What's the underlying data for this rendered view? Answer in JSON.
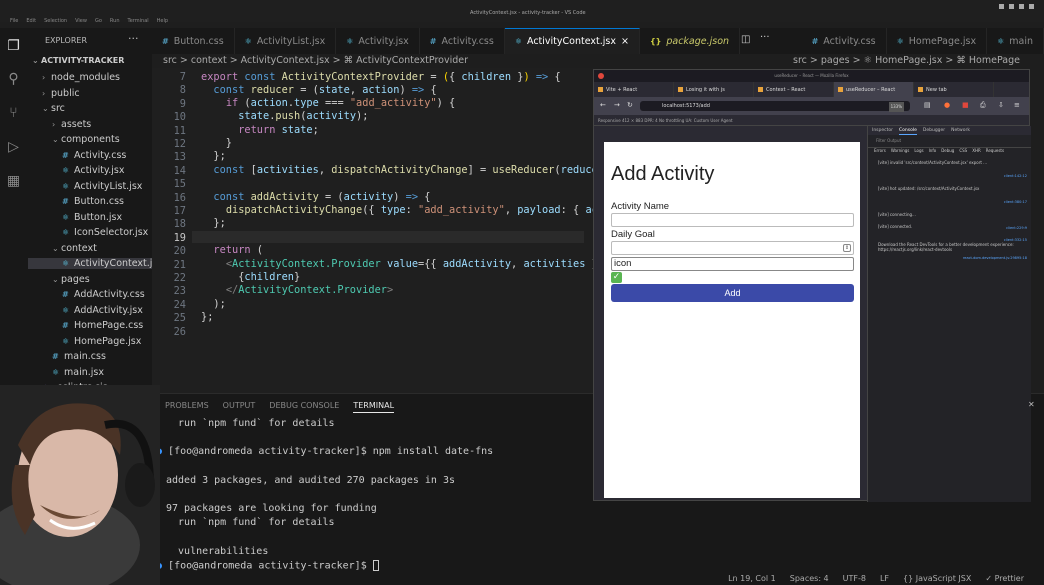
{
  "window": {
    "title": "ActivityContext.jsx - activity-tracker - VS Code"
  },
  "menu": [
    "File",
    "Edit",
    "Selection",
    "View",
    "Go",
    "Run",
    "Terminal",
    "Help"
  ],
  "explorer": {
    "title": "EXPLORER",
    "more": "···",
    "root": "ACTIVITY-TRACKER",
    "items": [
      {
        "label": "node_modules",
        "type": "folder",
        "open": false
      },
      {
        "label": "public",
        "type": "folder",
        "open": false
      },
      {
        "label": "src",
        "type": "folder",
        "open": true
      },
      {
        "label": "assets",
        "type": "folder",
        "open": false
      },
      {
        "label": "components",
        "type": "folder",
        "open": true
      },
      {
        "label": "Activity.css",
        "type": "css"
      },
      {
        "label": "Activity.jsx",
        "type": "jsx"
      },
      {
        "label": "ActivityList.jsx",
        "type": "jsx"
      },
      {
        "label": "Button.css",
        "type": "css"
      },
      {
        "label": "Button.jsx",
        "type": "jsx"
      },
      {
        "label": "IconSelector.jsx",
        "type": "jsx"
      },
      {
        "label": "context",
        "type": "folder",
        "open": true
      },
      {
        "label": "ActivityContext.jsx",
        "type": "jsx",
        "selected": true
      },
      {
        "label": "pages",
        "type": "folder",
        "open": true
      },
      {
        "label": "AddActivity.css",
        "type": "css"
      },
      {
        "label": "AddActivity.jsx",
        "type": "jsx"
      },
      {
        "label": "HomePage.css",
        "type": "css"
      },
      {
        "label": "HomePage.jsx",
        "type": "jsx"
      },
      {
        "label": "main.css",
        "type": "css"
      },
      {
        "label": "main.jsx",
        "type": "jsx"
      },
      {
        "label": ".eslintrc.cjs",
        "type": "eslint"
      }
    ]
  },
  "tabs": [
    {
      "label": "Button.css",
      "icon": "#",
      "iconColor": "#519aba"
    },
    {
      "label": "ActivityList.jsx",
      "icon": "⚛",
      "iconColor": "#61dafb"
    },
    {
      "label": "Activity.jsx",
      "icon": "⚛",
      "iconColor": "#61dafb"
    },
    {
      "label": "Activity.css",
      "icon": "#",
      "iconColor": "#519aba"
    },
    {
      "label": "ActivityContext.jsx",
      "icon": "⚛",
      "iconColor": "#61dafb",
      "active": true,
      "close": "×"
    },
    {
      "label": "package.json",
      "icon": "{}",
      "iconColor": "#cbcb41"
    },
    {
      "label": "Activity.css",
      "icon": "#",
      "iconColor": "#519aba"
    },
    {
      "label": "HomePage.jsx",
      "icon": "⚛",
      "iconColor": "#61dafb"
    },
    {
      "label": "main",
      "icon": "⚛",
      "iconColor": "#61dafb"
    }
  ],
  "breadcrumb": "src > context > ActivityContext.jsx > ⌘ ActivityContextProvider",
  "right_breadcrumb": "src > pages > ⚛ HomePage.jsx > ⌘ HomePage",
  "code": {
    "line_numbers": [
      "7",
      "8",
      "9",
      "10",
      "11",
      "12",
      "13",
      "14",
      "15",
      "16",
      "17",
      "18",
      "19",
      "20",
      "21",
      "22",
      "23",
      "24",
      "25",
      "26"
    ]
  },
  "panel": {
    "tabs": [
      "PROBLEMS",
      "OUTPUT",
      "DEBUG CONSOLE",
      "TERMINAL"
    ],
    "lines": [
      "  run `npm fund` for details",
      "",
      "[foo@andromeda activity-tracker]$ npm install date-fns",
      "",
      "added 3 packages, and audited 270 packages in 3s",
      "",
      "97 packages are looking for funding",
      "  run `npm fund` for details",
      "",
      "  vulnerabilities",
      "[foo@andromeda activity-tracker]$ "
    ]
  },
  "status": {
    "position": "Ln 19, Col 1",
    "spaces": "Spaces: 4",
    "encoding": "UTF-8",
    "eol": "LF",
    "language": "{} JavaScript JSX",
    "formatter": "✓ Prettier"
  },
  "browser": {
    "title": "useReducer – React — Mozilla Firefox",
    "tabs": [
      {
        "label": "Vite + React"
      },
      {
        "label": "Losing it with js"
      },
      {
        "label": "Context – React"
      },
      {
        "label": "useReducer – React",
        "selected": true
      },
      {
        "label": "New tab"
      }
    ],
    "url": "localhost:5173/add",
    "zoom": "133%",
    "devtools_bar": "Responsive   412 × 883   DPR: 4   No throttling   UA: Custom User Agent",
    "page": {
      "heading": "Add Activity",
      "activity_name_label": "Activity Name",
      "activity_name_value": "",
      "daily_goal_label": "Daily Goal",
      "daily_goal_value": "",
      "icon_value": "icon",
      "check_icon": "✓",
      "add_button": "Add"
    },
    "devtools": {
      "tabs": [
        "Inspector",
        "Console",
        "Debugger",
        "Network"
      ],
      "filter_placeholder": "Filter Output",
      "levels": [
        "Errors",
        "Warnings",
        "Logs",
        "Info",
        "Debug",
        "CSS",
        "XHR",
        "Requests"
      ],
      "log": [
        {
          "text": "[vite] invalid 'src/context/ActivityContext.jsx' export ...",
          "link": "client:142:12"
        },
        {
          "text": "[vite] hot updated: /src/context/ActivityContext.jsx",
          "link": "client:380:17"
        },
        {
          "text": "[vite] connecting...",
          "link": "client:229:9"
        },
        {
          "text": "[vite] connected.",
          "link": "client:332:15"
        },
        {
          "text": "Download the React DevTools for a better development experience: https://reactjs.org/link/react-devtools",
          "link": "react-dom.development.js:29895:18"
        }
      ]
    }
  },
  "colors": {
    "accent": "#0078d4",
    "button": "#3b4aa8",
    "check": "#5ab552"
  }
}
